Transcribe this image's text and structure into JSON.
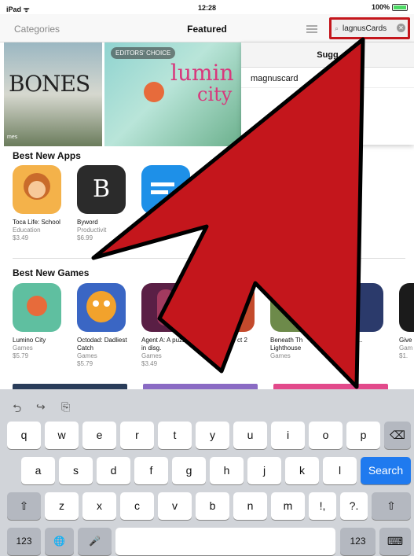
{
  "status": {
    "device": "iPad ᯤ",
    "time": "12:28",
    "battery": "100%"
  },
  "nav": {
    "categories": "Categories",
    "title": "Featured"
  },
  "search": {
    "mag": "⌕",
    "value": "lagnusCards",
    "clear": "✕"
  },
  "banners": {
    "left_title": "BONES",
    "left_sub": "mes",
    "editors": "EDITORS' CHOICE",
    "lumino_a": "lumin",
    "lumino_b": "city"
  },
  "suggestions": {
    "header": "Sugg",
    "items": [
      "magnuscard"
    ]
  },
  "best_new_apps": {
    "title": "Best New Apps",
    "apps": [
      {
        "name": "Toca Life: School",
        "category": "Education",
        "price": "$3.49",
        "color": "#f4b24a"
      },
      {
        "name": "Byword",
        "category": "Productivit",
        "price": "$6.99",
        "color": "#2b2b2b",
        "glyph": "B"
      },
      {
        "name": "",
        "category": "",
        "price": "",
        "color": "#1e90e8"
      }
    ]
  },
  "best_new_games": {
    "title": "Best New Games",
    "games": [
      {
        "name": "Lumino City",
        "category": "Games",
        "price": "$5.79",
        "color": "#5fbfa0"
      },
      {
        "name": "Octodad: Dadliest Catch",
        "category": "Games",
        "price": "$5.79",
        "color": "#3a66c4"
      },
      {
        "name": "Agent A: A puzzle in disg.",
        "category": "Games",
        "price": "$3.49",
        "color": "#5a1f45"
      },
      {
        "name": "ct 2",
        "category": "",
        "price": "",
        "color": "#c44a2c"
      },
      {
        "name": "Beneath Th Lighthouse",
        "category": "Games",
        "price": "",
        "color": "#6d8a4a"
      },
      {
        "name": "macy: E...",
        "category": "s",
        "price": "",
        "color": "#2b3a6b"
      },
      {
        "name": "Give",
        "category": "Gam",
        "price": "$1.",
        "color": "#1b1b1b"
      }
    ]
  },
  "keyboard": {
    "tools": [
      "⮌",
      "↪",
      "⎘"
    ],
    "row1": [
      "q",
      "w",
      "e",
      "r",
      "t",
      "y",
      "u",
      "i",
      "o",
      "p"
    ],
    "row2": [
      "a",
      "s",
      "d",
      "f",
      "g",
      "h",
      "j",
      "k",
      "l"
    ],
    "row3": [
      "z",
      "x",
      "c",
      "v",
      "b",
      "n",
      "m",
      "!,",
      "?."
    ],
    "backspace": "⌫",
    "search": "Search",
    "shift": "⇧",
    "num": "123",
    "globe": "🌐",
    "mic": "🎤",
    "hide": "⌨"
  },
  "colors": {
    "annotation_red": "#c4161c",
    "accent_blue": "#1f7aef"
  }
}
